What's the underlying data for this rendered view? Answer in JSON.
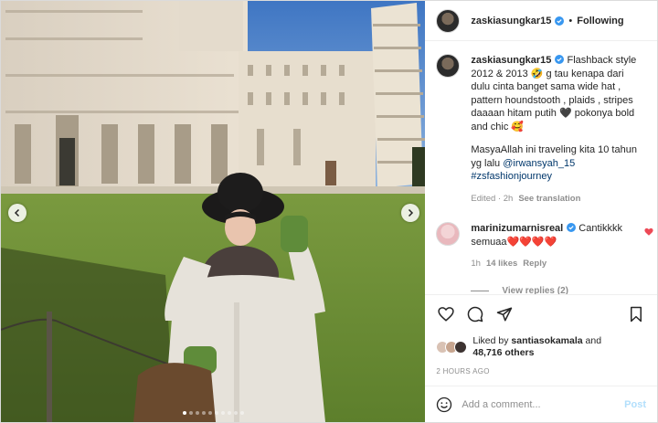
{
  "header": {
    "username": "zaskiasungkar15",
    "separator": "•",
    "follow_status": "Following"
  },
  "caption": {
    "username": "zaskiasungkar15",
    "text_part1": " Flashback style 2012 & 2013 🤣 g tau kenapa dari dulu cinta banget sama wide hat , pattern houndstooth , plaids , stripes daaaan hitam putih 🖤 pokonya bold and chic 🥰",
    "text_part2": "MasyaAllah ini traveling kita 10 tahun yg lalu ",
    "mention": "@irwansyah_15",
    "hashtag": "#zsfashionjourney",
    "edited": "Edited · 2h",
    "see_translation": "See translation"
  },
  "comment": {
    "username": "marinizumarnisreal",
    "text": " Cantikkkk semuaa❤️❤️❤️❤️",
    "age": "1h",
    "likes": "14 likes",
    "reply": "Reply",
    "view_replies": "View replies (2)"
  },
  "likes": {
    "prefix": "Liked by ",
    "user": "santiasokamala",
    "and": " and",
    "count": "48,716 others"
  },
  "timestamp": "2 HOURS AGO",
  "add_comment": {
    "placeholder": "Add a comment...",
    "post_label": "Post"
  },
  "carousel": {
    "total_slides": 10,
    "active_slide": 1
  },
  "colors": {
    "verified_blue": "#3897f0",
    "link_blue": "#00376b",
    "post_button_disabled": "#b2dffc",
    "like_red": "#ed4956",
    "muted_text": "#8e8e8e"
  }
}
